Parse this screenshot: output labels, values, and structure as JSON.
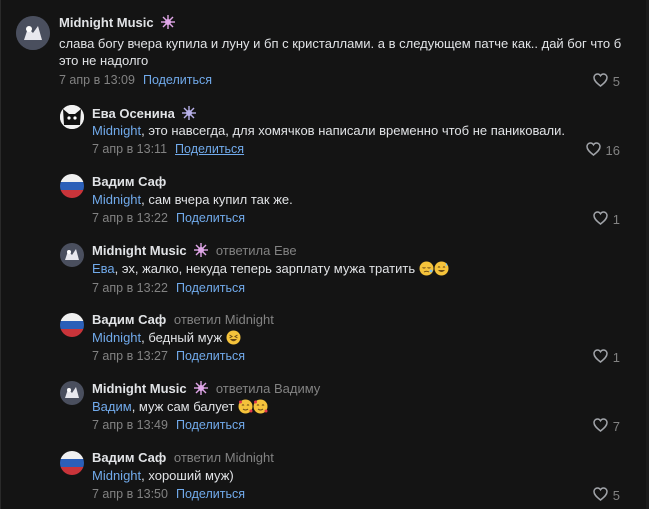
{
  "reply_label": "Поделиться",
  "comments": [
    {
      "author": "Midnight Music",
      "text": "слава богу вчера купила и луну и бп с кристаллами. а в следующем патче как.. дай бог что б это не надолго",
      "time": "7 апр в 13:09",
      "likes": "5"
    },
    {
      "author": "Ева Осенина",
      "mention": "Midnight",
      "text": ", это навсегда, для хомячков написали временно чтоб не паниковали.",
      "time": "7 апр в 13:11",
      "likes": "16"
    },
    {
      "author": "Вадим Саф",
      "mention": "Midnight",
      "text": ", сам вчера купил так же.",
      "time": "7 апр в 13:22",
      "likes": "1"
    },
    {
      "author": "Midnight Music",
      "replied_to": "ответила Еве",
      "mention": "Ева",
      "text": ", эх, жалко, некуда теперь зарплату мужа тратить",
      "time": "7 апр в 13:22",
      "likes": ""
    },
    {
      "author": "Вадим Саф",
      "replied_to": "ответил Midnight",
      "mention": "Midnight",
      "text": ", бедный муж",
      "time": "7 апр в 13:27",
      "likes": "1"
    },
    {
      "author": "Midnight Music",
      "replied_to": "ответила Вадиму",
      "mention": "Вадим",
      "text": ", муж сам балует",
      "time": "7 апр в 13:49",
      "likes": "7"
    },
    {
      "author": "Вадим Саф",
      "replied_to": "ответил Midnight",
      "mention": "Midnight",
      "text": ", хороший муж)",
      "time": "7 апр в 13:50",
      "likes": "5"
    }
  ]
}
